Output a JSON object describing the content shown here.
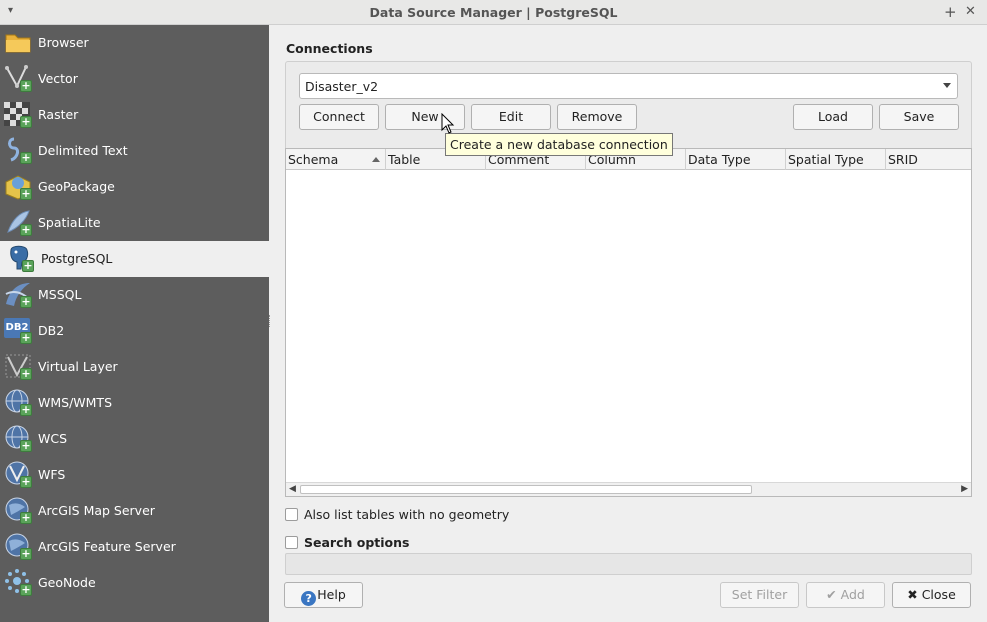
{
  "window": {
    "title": "Data Source Manager | PostgreSQL",
    "menu_glyph": "▾",
    "pin_glyph": "+",
    "close_glyph": "✕"
  },
  "sidebar": {
    "items": [
      {
        "label": "Browser",
        "icon": "folder-icon"
      },
      {
        "label": "Vector",
        "icon": "vector-icon"
      },
      {
        "label": "Raster",
        "icon": "raster-icon"
      },
      {
        "label": "Delimited Text",
        "icon": "delimited-text-icon"
      },
      {
        "label": "GeoPackage",
        "icon": "geopackage-icon"
      },
      {
        "label": "SpatiaLite",
        "icon": "spatialite-icon"
      },
      {
        "label": "PostgreSQL",
        "icon": "postgresql-icon",
        "selected": true
      },
      {
        "label": "MSSQL",
        "icon": "mssql-icon"
      },
      {
        "label": "DB2",
        "icon": "db2-icon"
      },
      {
        "label": "Virtual Layer",
        "icon": "virtual-layer-icon"
      },
      {
        "label": "WMS/WMTS",
        "icon": "wms-icon"
      },
      {
        "label": "WCS",
        "icon": "wcs-icon"
      },
      {
        "label": "WFS",
        "icon": "wfs-icon"
      },
      {
        "label": "ArcGIS Map Server",
        "icon": "arcgis-map-server-icon"
      },
      {
        "label": "ArcGIS Feature Server",
        "icon": "arcgis-feature-server-icon"
      },
      {
        "label": "GeoNode",
        "icon": "geonode-icon"
      }
    ],
    "plus_glyph": "+",
    "db2_text": "DB2"
  },
  "connections": {
    "title": "Connections",
    "selected": "Disaster_v2",
    "buttons": {
      "connect": "Connect",
      "new": "New",
      "edit": "Edit",
      "remove": "Remove",
      "load": "Load",
      "save": "Save"
    }
  },
  "tooltip": "Create a new database connection",
  "table": {
    "columns": [
      "Schema",
      "Table",
      "Comment",
      "Column",
      "Data Type",
      "Spatial Type",
      "SRID"
    ],
    "scroll_left": "◀",
    "scroll_right": "▶"
  },
  "options": {
    "list_no_geometry": "Also list tables with no geometry",
    "search_options": "Search options"
  },
  "footer": {
    "help": "Help",
    "help_glyph": "?",
    "set_filter": "Set Filter",
    "add": "Add",
    "add_glyph": "✔",
    "close": "Close",
    "close_glyph": "✖"
  },
  "colors": {
    "sidebar_bg": "#5d5d5d",
    "selected_bg": "#efefef",
    "tooltip_bg": "#ffffdc",
    "add_green": "#5aa35a"
  }
}
